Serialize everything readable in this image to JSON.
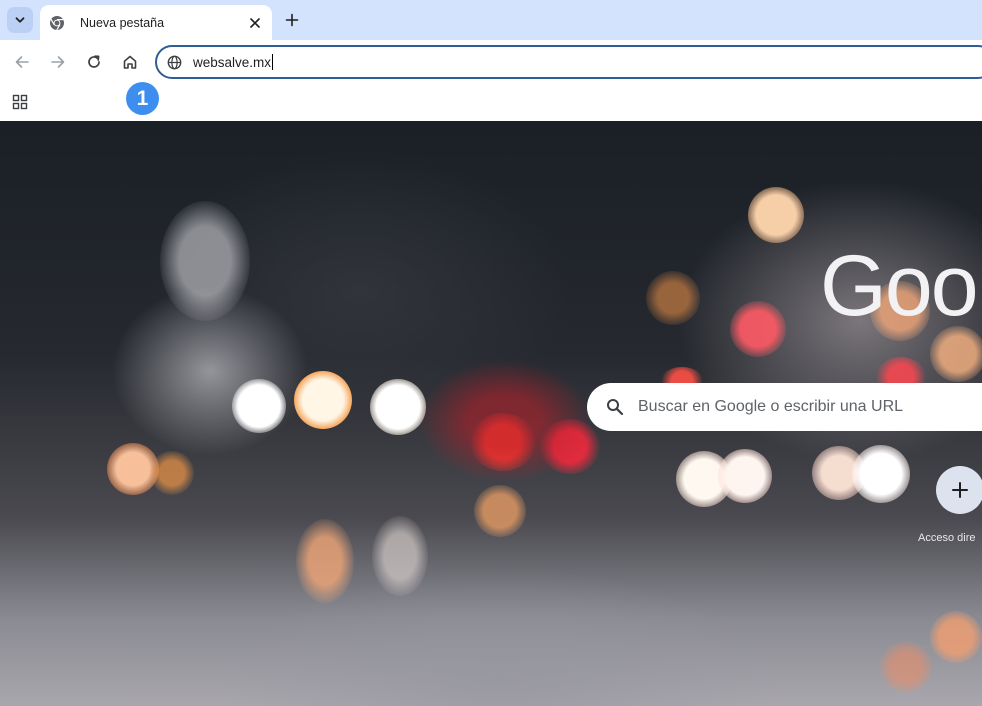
{
  "browser": {
    "tab": {
      "title": "Nueva pestaña"
    },
    "address_bar": {
      "value": "websalve.mx"
    },
    "step_badge": "1"
  },
  "icons": {
    "tab_search": "chevron-down-icon",
    "tab_favicon": "chrome-icon",
    "tab_close": "close-icon",
    "new_tab": "plus-icon",
    "back": "arrow-left-icon",
    "forward": "arrow-right-icon",
    "reload": "reload-icon",
    "home": "home-icon",
    "site_info": "globe-icon",
    "apps": "apps-grid-icon",
    "search": "search-icon",
    "add_shortcut": "plus-icon"
  },
  "ntp": {
    "logo_text": "Goo",
    "search_placeholder": "Buscar en Google o escribir una URL",
    "shortcut_label": "Acceso dire"
  },
  "colors": {
    "tabstrip": "#d3e3fd",
    "omnibox_border": "#2f5e96",
    "badge": "#3e8ef0"
  }
}
